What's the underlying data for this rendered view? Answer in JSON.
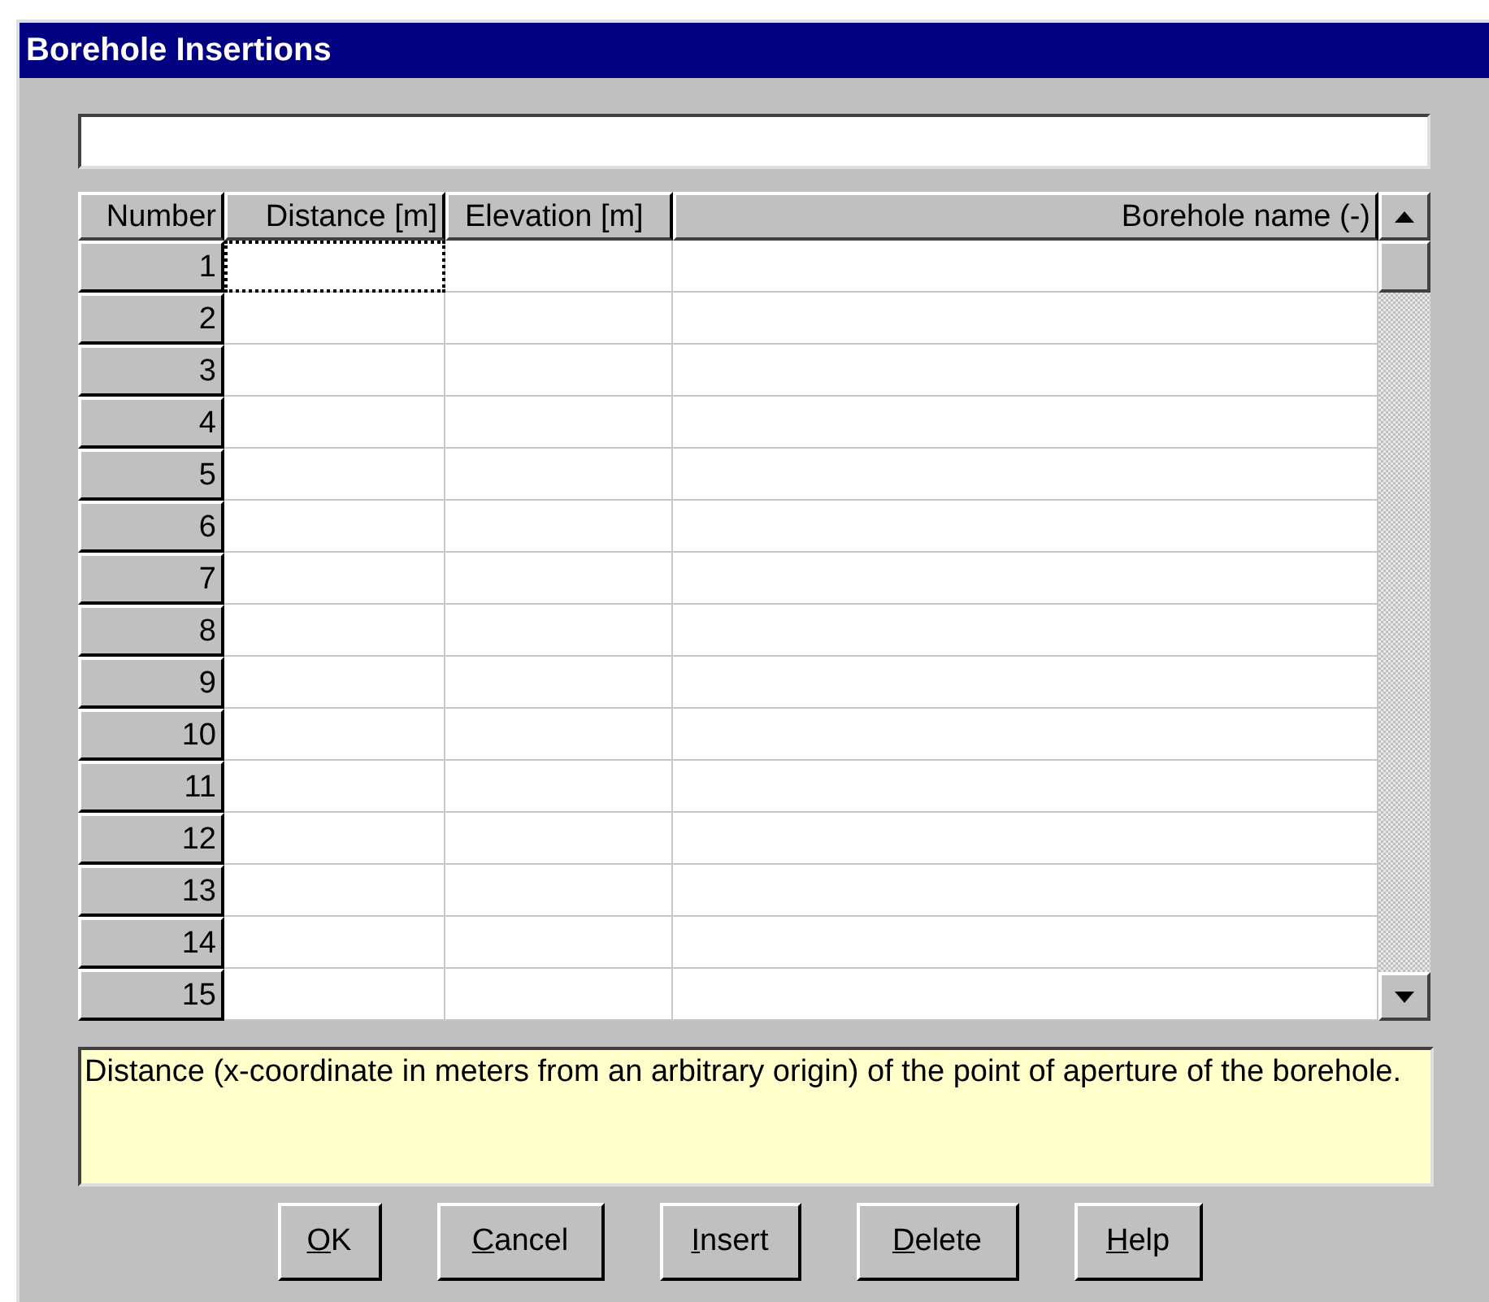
{
  "window": {
    "title": "Borehole Insertions"
  },
  "table": {
    "columns": [
      "Number",
      "Distance [m]",
      "Elevation [m]",
      "Borehole name (-)"
    ],
    "rows": [
      {
        "number": "1",
        "cells": [
          {
            "focused": true
          },
          {
            "focused": false
          },
          {
            "focused": false
          }
        ]
      },
      {
        "number": "2",
        "cells": [
          {
            "focused": false
          },
          {
            "focused": false
          },
          {
            "focused": false
          }
        ]
      },
      {
        "number": "3",
        "cells": [
          {
            "focused": false
          },
          {
            "focused": false
          },
          {
            "focused": false
          }
        ]
      },
      {
        "number": "4",
        "cells": [
          {
            "focused": false
          },
          {
            "focused": false
          },
          {
            "focused": false
          }
        ]
      },
      {
        "number": "5",
        "cells": [
          {
            "focused": false
          },
          {
            "focused": false
          },
          {
            "focused": false
          }
        ]
      },
      {
        "number": "6",
        "cells": [
          {
            "focused": false
          },
          {
            "focused": false
          },
          {
            "focused": false
          }
        ]
      },
      {
        "number": "7",
        "cells": [
          {
            "focused": false
          },
          {
            "focused": false
          },
          {
            "focused": false
          }
        ]
      },
      {
        "number": "8",
        "cells": [
          {
            "focused": false
          },
          {
            "focused": false
          },
          {
            "focused": false
          }
        ]
      },
      {
        "number": "9",
        "cells": [
          {
            "focused": false
          },
          {
            "focused": false
          },
          {
            "focused": false
          }
        ]
      },
      {
        "number": "10",
        "cells": [
          {
            "focused": false
          },
          {
            "focused": false
          },
          {
            "focused": false
          }
        ]
      },
      {
        "number": "11",
        "cells": [
          {
            "focused": false
          },
          {
            "focused": false
          },
          {
            "focused": false
          }
        ]
      },
      {
        "number": "12",
        "cells": [
          {
            "focused": false
          },
          {
            "focused": false
          },
          {
            "focused": false
          }
        ]
      },
      {
        "number": "13",
        "cells": [
          {
            "focused": false
          },
          {
            "focused": false
          },
          {
            "focused": false
          }
        ]
      },
      {
        "number": "14",
        "cells": [
          {
            "focused": false
          },
          {
            "focused": false
          },
          {
            "focused": false
          }
        ]
      },
      {
        "number": "15",
        "cells": [
          {
            "focused": false
          },
          {
            "focused": false
          },
          {
            "focused": false
          }
        ]
      }
    ]
  },
  "help_text": "Distance (x-coordinate in meters from an arbitrary origin) of the point of aperture of the borehole.",
  "buttons": [
    {
      "label": "OK",
      "mnemonic_first": true
    },
    {
      "label": "Cancel",
      "mnemonic_first": true
    },
    {
      "label": "Insert",
      "mnemonic_first": true
    },
    {
      "label": "Delete",
      "mnemonic_first": true
    },
    {
      "label": "Help",
      "mnemonic_first": true
    }
  ]
}
